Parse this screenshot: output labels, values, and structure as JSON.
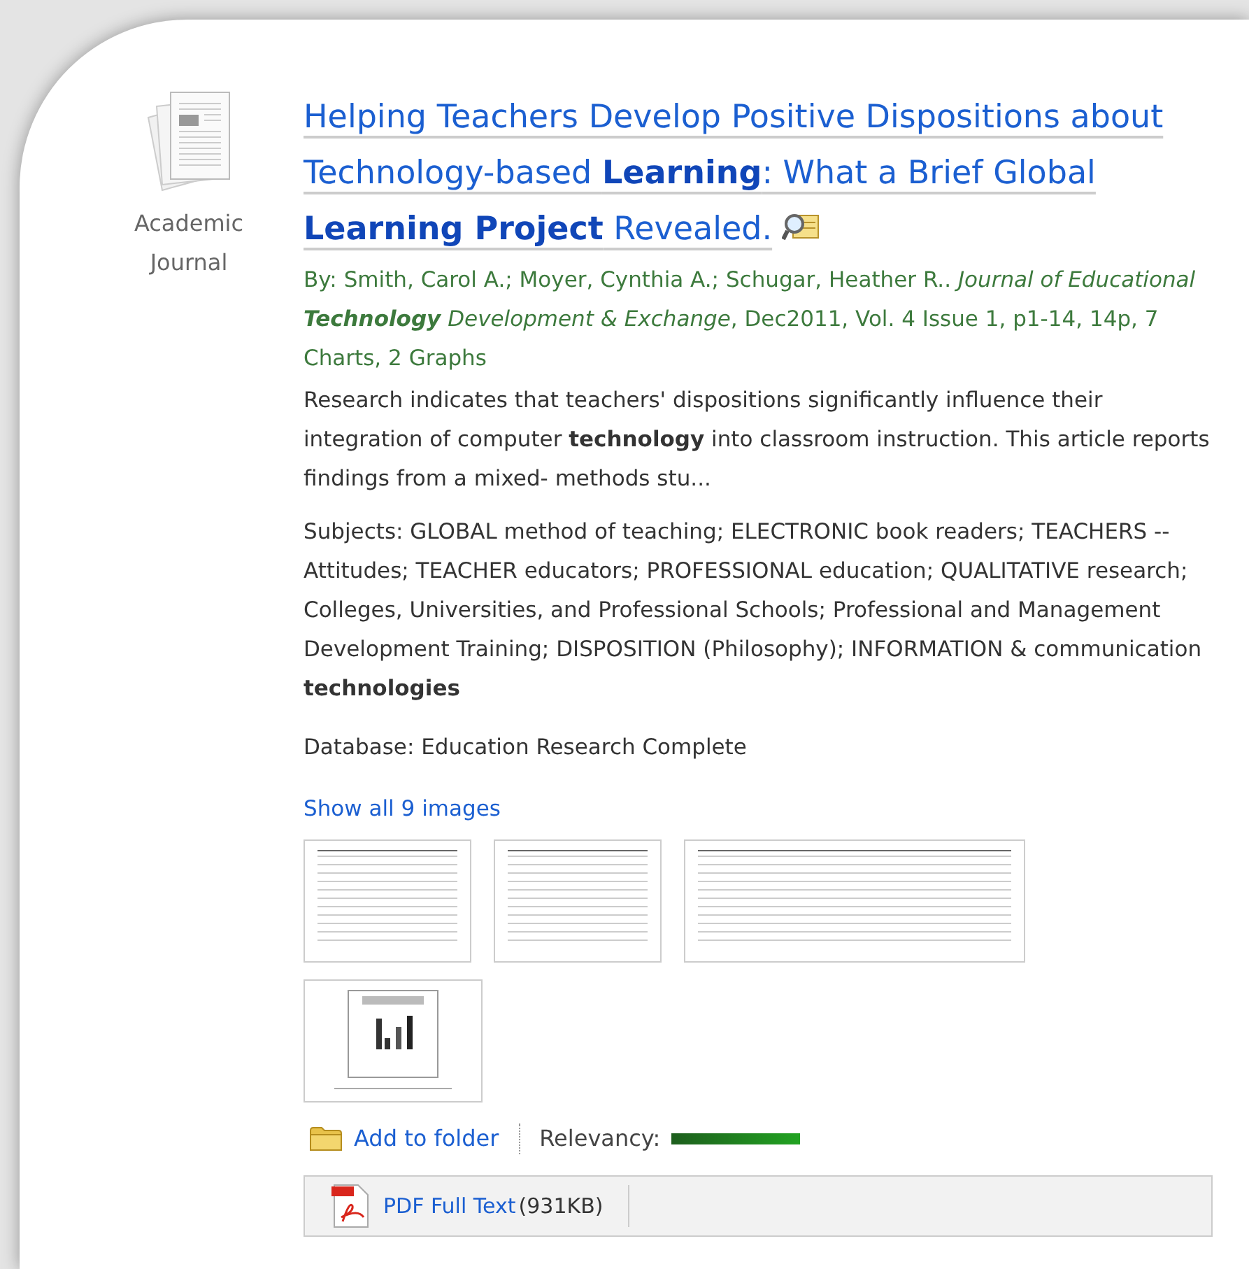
{
  "record": {
    "type_label": "Academic Journal",
    "title": "Helping Teachers Develop Positive Dispositions about Technology-based **Learning**: What a Brief Global **Learning Project** Revealed.",
    "source": "By: Smith, Carol A.; Moyer, Cynthia A.; Schugar, Heather R.. *Journal of Educational* **Technology** *Development & Exchange*, Dec2011, Vol. 4 Issue 1, p1-14, 14p, 7 Charts, 2 Graphs",
    "abstract": "Research indicates that teachers' dispositions significantly influence their integration of computer **technology** into classroom instruction. This article reports findings from a mixed- methods stu...",
    "subjects": "Subjects: GLOBAL method of teaching; ELECTRONIC book readers; TEACHERS -- Attitudes; TEACHER educators; PROFESSIONAL education; QUALITATIVE research; Colleges, Universities, and Professional Schools; Professional and Management Development Training; DISPOSITION (Philosophy); INFORMATION & communication **technologies**",
    "database": "Database: Education Research Complete",
    "images_link": "Show all 9 images",
    "images": [
      {
        "kind": "table"
      },
      {
        "kind": "table"
      },
      {
        "kind": "wide-table"
      },
      {
        "kind": "chart"
      }
    ],
    "add_to_folder": "Add to folder",
    "relevancy": {
      "label": "Relevancy:",
      "level": 1
    },
    "full_text": {
      "label": "PDF Full Text",
      "size": "(931KB)"
    }
  }
}
